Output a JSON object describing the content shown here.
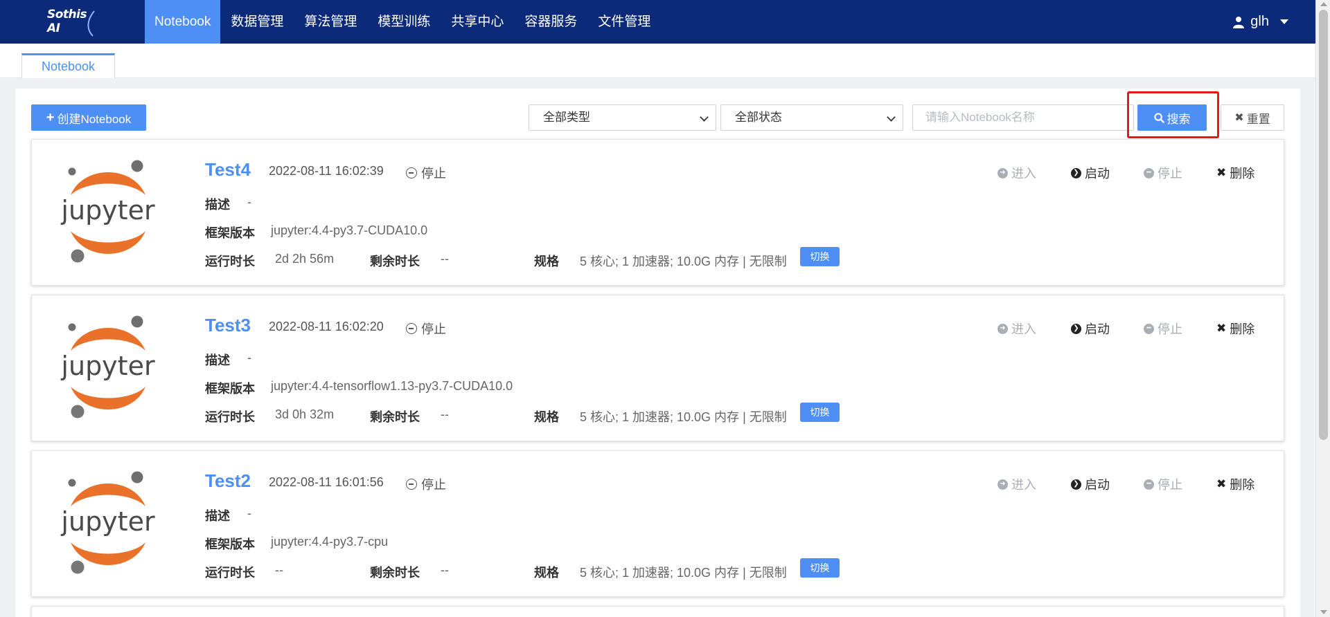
{
  "nav": {
    "logo": "Sothis AI",
    "items": [
      "Notebook",
      "数据管理",
      "算法管理",
      "模型训练",
      "共享中心",
      "容器服务",
      "文件管理"
    ],
    "user": "glh"
  },
  "subtab": "Notebook",
  "toolbar": {
    "create_label": "创建Notebook",
    "type_select": "全部类型",
    "status_select": "全部状态",
    "search_placeholder": "请输入Notebook名称",
    "search_label": "搜索",
    "reset_label": "重置"
  },
  "labels": {
    "desc": "描述",
    "framework": "框架版本",
    "runtime": "运行时长",
    "remaining": "剩余时长",
    "spec": "规格",
    "switch": "切换"
  },
  "actions": {
    "enter": "进入",
    "start": "启动",
    "stop": "停止",
    "delete": "删除"
  },
  "notebooks": [
    {
      "name": "Test4",
      "created": "2022-08-11 16:02:39",
      "status": "停止",
      "desc": "-",
      "framework": "jupyter:4.4-py3.7-CUDA10.0",
      "runtime": "2d 2h 56m",
      "remaining": "--",
      "spec": "5 核心; 1 加速器; 10.0G 内存 | 无限制"
    },
    {
      "name": "Test3",
      "created": "2022-08-11 16:02:20",
      "status": "停止",
      "desc": "-",
      "framework": "jupyter:4.4-tensorflow1.13-py3.7-CUDA10.0",
      "runtime": "3d 0h 32m",
      "remaining": "--",
      "spec": "5 核心; 1 加速器; 10.0G 内存 | 无限制"
    },
    {
      "name": "Test2",
      "created": "2022-08-11 16:01:56",
      "status": "停止",
      "desc": "-",
      "framework": "jupyter:4.4-py3.7-cpu",
      "runtime": "--",
      "remaining": "--",
      "spec": "5 核心; 1 加速器; 10.0G 内存 | 无限制"
    }
  ],
  "colors": {
    "nav_bg": "#0c2a7a",
    "accent": "#4d8ff5",
    "highlight": "#e8171a",
    "jupyter_orange": "#e9712a"
  }
}
